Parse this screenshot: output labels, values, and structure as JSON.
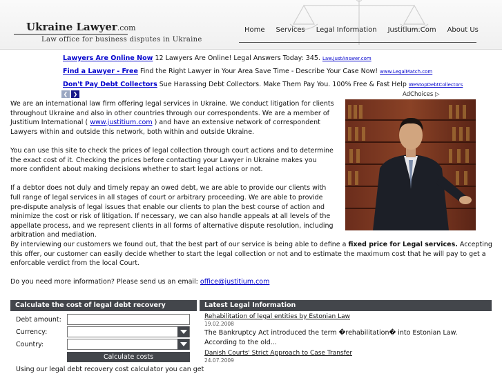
{
  "header": {
    "logo_title": "Ukraine Lawyer",
    "logo_domain": ".com",
    "logo_subtitle": "Law office for business disputes in Ukraine",
    "nav": [
      "Home",
      "Services",
      "Legal Information",
      "Justitium.Com",
      "About Us"
    ]
  },
  "ads": [
    {
      "title": "Lawyers Are Online Now",
      "text": "12 Lawyers Are Online! Legal Answers Today: 345.",
      "url": "Law.JustAnswer.com"
    },
    {
      "title": "Find a Lawyer - Free",
      "text": "Find the Right Lawyer in Your Area Save Time - Describe Your Case Now!",
      "url": "www.LegalMatch.com"
    },
    {
      "title": "Don't Pay Debt Collectors",
      "text": "Sue Harassing Debt Collectors. Make Them Pay You. 100% Free & Fast Help",
      "url": "WeStopDebtCollectors"
    }
  ],
  "ad_nav": {
    "prev": "❮",
    "next": "❯",
    "adchoices": "AdChoices ▷"
  },
  "intro": {
    "p1_a": "We are an international law firm offering legal services in Ukraine. We conduct litigation for clients throughout Ukraine and also in other countries through our correspondents. We are a member of Justitium International ( ",
    "p1_link": "www.justitium.com",
    "p1_b": " ) and have an extensive network of correspondent Lawyers within and outside this network, both within and outside Ukraine.",
    "p2": "You can use this site to check the prices of legal collection through court actions and to determine the exact cost of it. Checking the prices before contacting your Lawyer in Ukraine makes you more confident about making decisions whether to start legal actions or not.",
    "p3": "If a debtor does not duly and timely repay an owed debt, we are able to provide our clients with full range of legal services in all stages of court or arbitrary proceeding. We are able to provide pre-dispute analysis of legal issues that enable our clients to plan the best course of action and minimize the cost or risk of litigation. If necessary, we can also handle appeals at all levels of the appellate process, and we represent clients in all forms of alternative dispute resolution, including arbitration and mediation."
  },
  "wide": {
    "p4_a": "By interviewing our customers we found out, that the best part of our service is being able to define a ",
    "p4_bold": "fixed price for Legal services.",
    "p4_b": " Accepting this offer, our customer can easily decide whether to start the legal collection or not and to estimate the maximum cost that he will pay to get a enforcable verdict from the local Court.",
    "p5_a": "Do you need more information? Please send us an email: ",
    "p5_link": "office@justitium.com"
  },
  "calc": {
    "title": "Calculate the cost of legal debt recovery",
    "debt_label": "Debt amount:",
    "debt_value": "",
    "currency_label": "Currency:",
    "currency_value": "",
    "country_label": "Country:",
    "country_value": "",
    "button": "Calculate costs",
    "note": "Using our legal debt recovery cost calculator you can get"
  },
  "news": {
    "title": "Latest Legal Information",
    "items": [
      {
        "title": "Rehabilitation of legal entities by Estonian Law",
        "date": "19.02.2008",
        "text": "The Bankruptcy Act introduced the term �rehabilitation� into Estonian Law. According to the old..."
      },
      {
        "title": "Danish Courts' Strict Approach to Case Transfer",
        "date": "24.07.2009",
        "text": ""
      }
    ]
  },
  "colors": {
    "panel": "#43464b",
    "link": "#0000cc"
  }
}
